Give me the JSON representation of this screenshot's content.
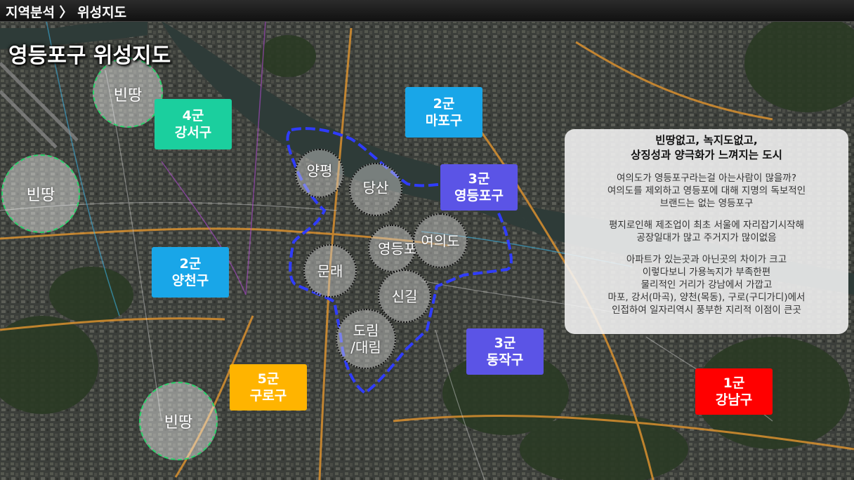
{
  "header": {
    "breadcrumb": "지역분석 〉 위성지도"
  },
  "page_title": "영등포구 위성지도",
  "colors": {
    "gun1": "#ff0000",
    "gun2": "#19a6e8",
    "gun3": "#5b54e6",
    "gun4": "#1bcf9e",
    "gun5": "#ffb400",
    "boundary": "#2f3cff"
  },
  "district_badges": [
    {
      "id": "gangseo",
      "tier": "4군",
      "name": "강서구"
    },
    {
      "id": "mapo",
      "tier": "2군",
      "name": "마포구"
    },
    {
      "id": "yeongdeungpo",
      "tier": "3군",
      "name": "영등포구"
    },
    {
      "id": "yangcheon",
      "tier": "2군",
      "name": "양천구"
    },
    {
      "id": "dongjak",
      "tier": "3군",
      "name": "동작구"
    },
    {
      "id": "guro",
      "tier": "5군",
      "name": "구로구"
    },
    {
      "id": "gangnam",
      "tier": "1군",
      "name": "강남구"
    }
  ],
  "neighborhoods": [
    {
      "id": "yangpyeong",
      "lines": [
        "양평"
      ]
    },
    {
      "id": "dangsan",
      "lines": [
        "당산"
      ]
    },
    {
      "id": "yeongdeungpo-dong",
      "lines": [
        "영등포"
      ]
    },
    {
      "id": "yeouido",
      "lines": [
        "여의도"
      ]
    },
    {
      "id": "mullae",
      "lines": [
        "문래"
      ]
    },
    {
      "id": "singil",
      "lines": [
        "신길"
      ]
    },
    {
      "id": "dorim-daerim",
      "lines": [
        "도림",
        "/대림"
      ]
    }
  ],
  "blank_areas": [
    {
      "id": "blank-1",
      "label": "빈땅"
    },
    {
      "id": "blank-2",
      "label": "빈땅"
    },
    {
      "id": "blank-3",
      "label": "빈땅"
    }
  ],
  "info_box": {
    "heading_lines": [
      "빈땅없고, 녹지도없고,",
      "상징성과 양극화가 느껴지는 도시"
    ],
    "paragraphs": [
      [
        "여의도가 영등포구라는걸 아는사람이 많을까?",
        "여의도를 제외하고 영등포에 대해 지명의 독보적인",
        "브랜드는 없는 영등포구"
      ],
      [
        "평지로인해 제조업이 최초 서울에 자리잡기시작해",
        "공장일대가 많고 주거지가 많이없음"
      ],
      [
        "아파트가 있는곳과 아닌곳의 차이가 크고",
        "이렇다보니 가용녹지가 부족한편",
        "물리적인 거리가 강남에서 가깝고",
        "마포, 강서(마곡), 양천(목동), 구로(구디가디)에서",
        "인접하여 일자리역시 풍부한 지리적 이점이 큰곳"
      ]
    ]
  }
}
